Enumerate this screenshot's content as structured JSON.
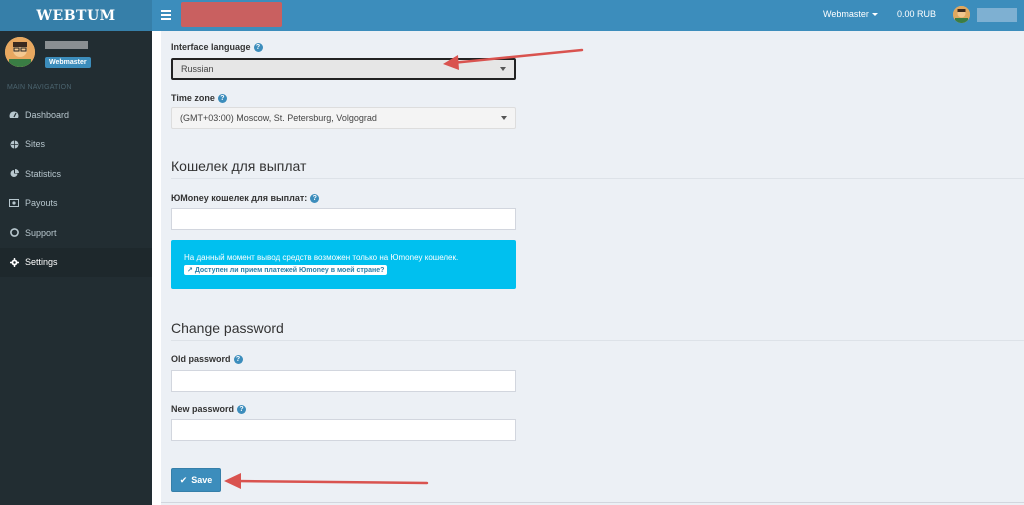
{
  "app": {
    "logo": "WEBTUM"
  },
  "topbar": {
    "role_label": "Webmaster",
    "balance": "0.00 RUB"
  },
  "sidebar": {
    "user_role_badge": "Webmaster",
    "nav_header": "MAIN NAVIGATION",
    "items": [
      {
        "label": "Dashboard",
        "icon": "dashboard-icon",
        "active": false
      },
      {
        "label": "Sites",
        "icon": "globe-icon",
        "active": false
      },
      {
        "label": "Statistics",
        "icon": "pie-chart-icon",
        "active": false
      },
      {
        "label": "Payouts",
        "icon": "money-icon",
        "active": false
      },
      {
        "label": "Support",
        "icon": "lifebuoy-icon",
        "active": false
      },
      {
        "label": "Settings",
        "icon": "gear-icon",
        "active": true
      }
    ]
  },
  "form": {
    "interface_language_label": "Interface language",
    "interface_language_value": "Russian",
    "timezone_label": "Time zone",
    "timezone_value": "(GMT+03:00) Moscow, St. Petersburg, Volgograd",
    "wallet_section_title": "Кошелек для выплат",
    "wallet_label": "ЮMoney кошелек для выплат:",
    "wallet_value": "",
    "info_text": "На данный момент вывод средств возможен только на Юmoney кошелек.",
    "info_link": "Доступен ли прием платежей Юmoney в моей стране?",
    "password_section_title": "Change password",
    "old_password_label": "Old password",
    "new_password_label": "New password",
    "save_label": "Save"
  },
  "colors": {
    "accent": "#3c8dbc",
    "sidebar": "#222d32",
    "info": "#00c0ef",
    "annotation_arrow": "#d9534f"
  }
}
